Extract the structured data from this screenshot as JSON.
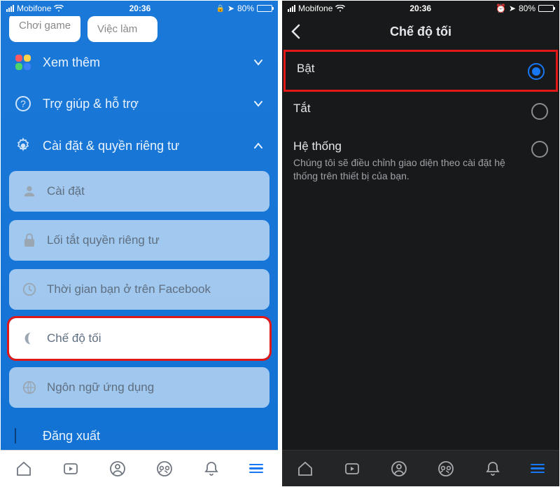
{
  "status": {
    "carrier": "Mobifone",
    "time": "20:36",
    "battery_pct": "80%",
    "battery_fill_pct": 80
  },
  "left": {
    "chips": {
      "game": "Chơi game",
      "jobs": "Việc làm"
    },
    "see_more": "Xem thêm",
    "help": "Trợ giúp & hỗ trợ",
    "settings_privacy": "Cài đặt & quyền riêng tư",
    "cards": {
      "settings": "Cài đặt",
      "privacy_shortcut": "Lối tắt quyền riêng tư",
      "time_on_fb": "Thời gian bạn ở trên Facebook",
      "dark_mode": "Chế độ tối",
      "app_language": "Ngôn ngữ ứng dụng"
    },
    "logout": "Đăng xuất"
  },
  "right": {
    "title": "Chế độ tối",
    "options": {
      "on": "Bật",
      "off": "Tắt",
      "system_title": "Hệ thống",
      "system_sub": "Chúng tôi sẽ điều chỉnh giao diện theo cài đặt hệ thống trên thiết bị của bạn."
    }
  }
}
